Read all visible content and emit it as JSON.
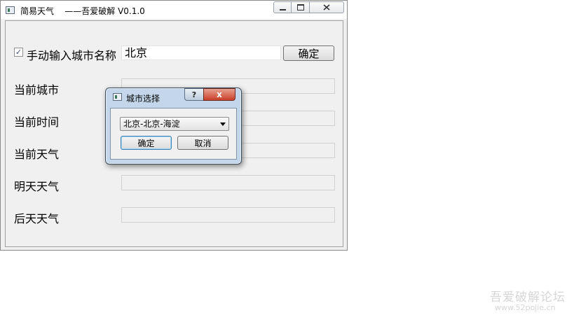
{
  "main_window": {
    "title": "简易天气    ——吾爱破解 V0.1.0",
    "manual_checkbox": {
      "checked": true,
      "label": "手动输入城市名称"
    },
    "city_input": {
      "value": "北京"
    },
    "confirm_label": "确定",
    "fields": [
      {
        "label": "当前城市",
        "value": ""
      },
      {
        "label": "当前时间",
        "value": ""
      },
      {
        "label": "当前天气",
        "value": ""
      },
      {
        "label": "明天天气",
        "value": ""
      },
      {
        "label": "后天天气",
        "value": ""
      }
    ]
  },
  "dialog": {
    "title": "城市选择",
    "help_glyph": "?",
    "close_glyph": "x",
    "selected_city": "北京-北京-海淀",
    "ok_label": "确定",
    "cancel_label": "取消"
  },
  "watermark": {
    "line1": "吾爱破解论坛",
    "line2": "www.52pojie.cn"
  },
  "icons": {
    "app": "window-app-icon",
    "minimize": "minimize-icon",
    "maximize": "maximize-icon",
    "close": "close-icon",
    "help": "help-icon",
    "dropdown": "chevron-down-icon"
  }
}
